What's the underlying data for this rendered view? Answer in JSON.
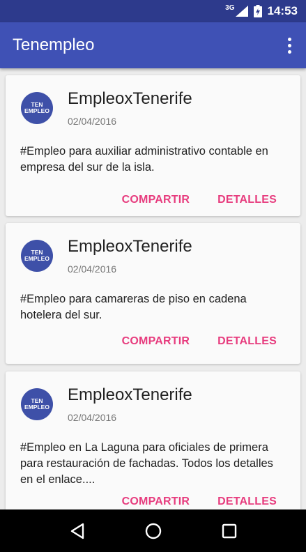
{
  "status_bar": {
    "network": "3G",
    "time": "14:53"
  },
  "app_bar": {
    "title": "Tenempleo"
  },
  "avatar_text": {
    "line1": "TEN",
    "line2": "EMPLEO"
  },
  "posts": [
    {
      "author": "EmpleoxTenerife",
      "date": "02/04/2016",
      "text": "#Empleo para auxiliar administrativo contable en empresa del sur de la isla.",
      "share_label": "COMPARTIR",
      "details_label": "DETALLES"
    },
    {
      "author": "EmpleoxTenerife",
      "date": "02/04/2016",
      "text": "#Empleo para camareras de piso en cadena hotelera del sur.",
      "share_label": "COMPARTIR",
      "details_label": "DETALLES"
    },
    {
      "author": "EmpleoxTenerife",
      "date": "02/04/2016",
      "text": "#Empleo en La Laguna para oficiales de primera para restauración de fachadas. Todos los detalles en el enlace....",
      "share_label": "COMPARTIR",
      "details_label": "DETALLES"
    }
  ],
  "colors": {
    "status_bar": "#2d3a8c",
    "app_bar": "#3f51b5",
    "accent": "#e73c7e",
    "avatar": "#3e50a8"
  },
  "icons": {
    "overflow": "more-vert-icon",
    "back": "back-icon",
    "home": "home-icon",
    "recents": "recents-icon"
  }
}
